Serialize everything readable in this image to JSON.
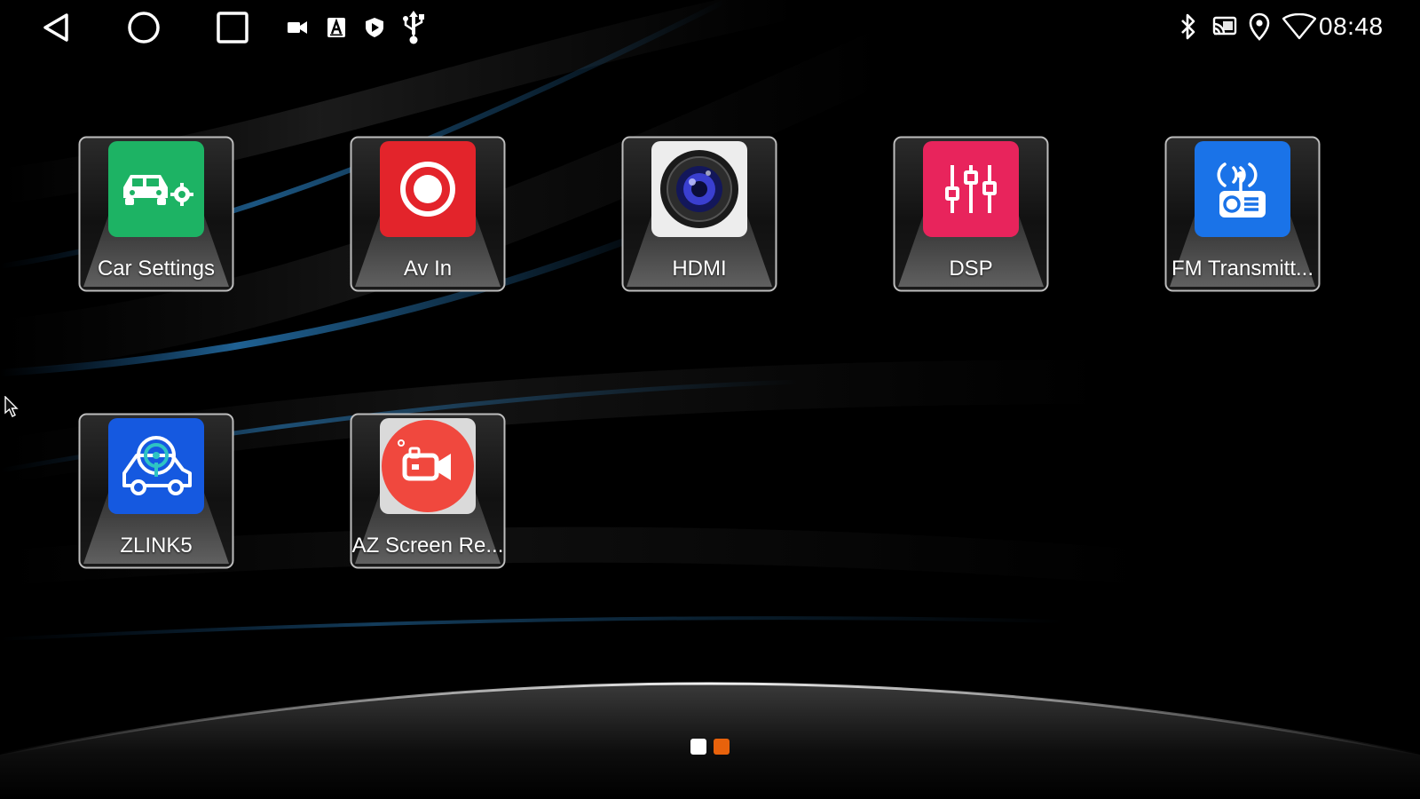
{
  "status_bar": {
    "nav": [
      {
        "name": "back-icon"
      },
      {
        "name": "home-icon"
      },
      {
        "name": "recents-icon"
      }
    ],
    "notifications": [
      "video-camera-icon",
      "font-a-icon",
      "shield-play-icon",
      "usb-icon"
    ],
    "system": [
      "bluetooth-icon",
      "cast-icon",
      "location-pin-icon",
      "wifi-icon"
    ],
    "time": "08:48"
  },
  "apps": [
    {
      "id": "car-settings",
      "label": "Car Settings",
      "icon": "car-settings-icon",
      "color": "#1DB364"
    },
    {
      "id": "av-in",
      "label": "Av In",
      "icon": "record-icon",
      "color": "#E3242B"
    },
    {
      "id": "hdmi",
      "label": "HDMI",
      "icon": "camera-lens-icon",
      "color": "#EDEDED"
    },
    {
      "id": "dsp",
      "label": "DSP",
      "icon": "equalizer-icon",
      "color": "#E8245C"
    },
    {
      "id": "fm-transmitter",
      "label": "FM Transmitt...",
      "icon": "radio-icon",
      "color": "#1A73E8"
    },
    {
      "id": "zlink5",
      "label": "ZLINK5",
      "icon": "zlink-car-icon",
      "color": "#1559E0"
    },
    {
      "id": "az-screen-recorder",
      "label": "AZ Screen Re...",
      "icon": "screen-recorder-icon",
      "color": "#F0483E"
    }
  ],
  "pager": {
    "pages": 2,
    "active": 1,
    "colors": {
      "inactive": "#FFFFFF",
      "active": "#E8620C"
    }
  }
}
